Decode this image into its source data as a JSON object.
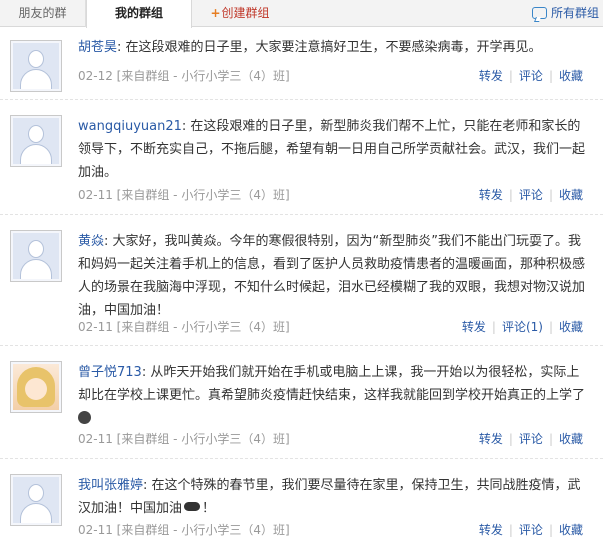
{
  "tabs": {
    "friends_groups": "朋友的群",
    "my_groups": "我的群组",
    "create_group": "创建群组",
    "all_groups": "所有群组"
  },
  "posts": [
    {
      "author": "胡苍昊",
      "text": "在这段艰难的日子里，大家要注意搞好卫生，不要感染病毒，开学再见。",
      "meta": "02-12 [来自群组 - 小行小学三（4）班]",
      "forward": "转发",
      "comment": "评论",
      "favorite": "收藏",
      "avatar_icon": "default-avatar-icon"
    },
    {
      "author": "wangqiuyuan21",
      "text": "在这段艰难的日子里，新型肺炎我们帮不上忙，只能在老师和家长的领导下，不断充实自己，不拖后腿，希望有朝一日用自己所学贡献社会。武汉，我们一起加油。",
      "meta": "02-11 [来自群组 - 小行小学三（4）班]",
      "forward": "转发",
      "comment": "评论",
      "favorite": "收藏",
      "avatar_icon": "default-avatar-icon"
    },
    {
      "author": "黄焱",
      "text": "大家好，我叫黄焱。今年的寒假很特别，因为“新型肺炎”我们不能出门玩耍了。我和妈妈一起关注着手机上的信息，看到了医护人员救助疫情患者的温暖画面，那种积极感人的场景在我脑海中浮现，不知什么时候起，泪水已经模糊了我的双眼，我想对物汉说加油，中国加油！",
      "meta": "02-11 [来自群组 - 小行小学三（4）班]",
      "forward": "转发",
      "comment": "评论(1)",
      "favorite": "收藏",
      "avatar_icon": "default-avatar-icon"
    },
    {
      "author": "曾子悦713",
      "text": "从昨天开始我们就开始在手机或电脑上上课，我一开始以为很轻松，实际上却比在学校上课更忙。真希望肺炎疫情赶快结束，这样我就能回到学校开始真正的上学了",
      "meta": "02-11 [来自群组 - 小行小学三（4）班]",
      "forward": "转发",
      "comment": "评论",
      "favorite": "收藏",
      "avatar_icon": "girl-avatar-icon"
    },
    {
      "author": "我叫张雅婷",
      "text": "在这个特殊的春节里，我们要尽量待在家里，保持卫生，共同战胜疫情，武汉加油！中国加油",
      "text_end": "！",
      "meta": "02-11 [来自群组 - 小行小学三（4）班]",
      "forward": "转发",
      "comment": "评论",
      "favorite": "收藏",
      "avatar_icon": "default-avatar-icon"
    }
  ]
}
